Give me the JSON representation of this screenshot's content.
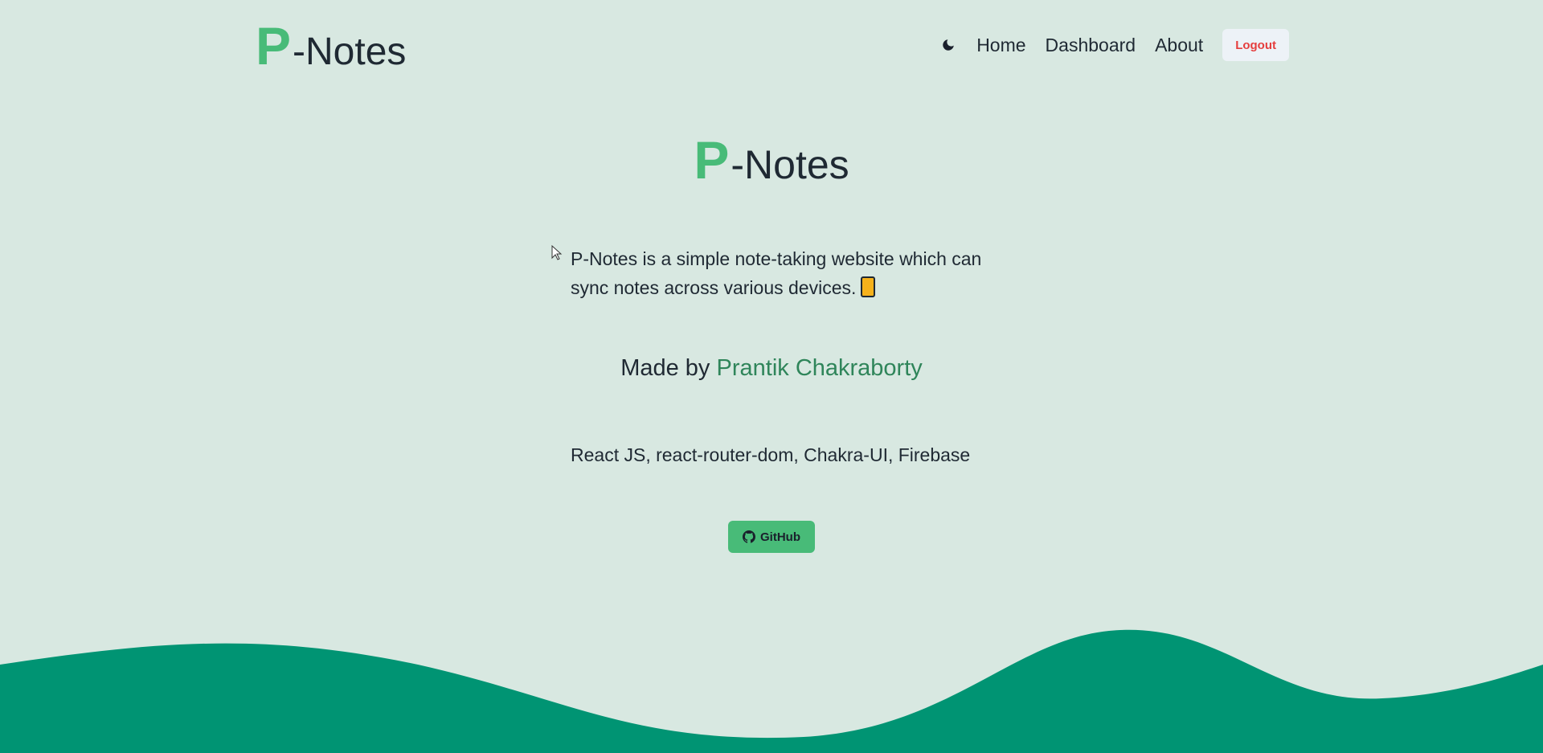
{
  "header": {
    "brand_p": "P",
    "brand_rest": "-Notes",
    "nav": {
      "home": "Home",
      "dashboard": "Dashboard",
      "about": "About"
    },
    "logout_label": "Logout",
    "theme_icon": "moon-icon"
  },
  "main": {
    "title_p": "P",
    "title_rest": "-Notes",
    "description": "P-Notes is a simple note-taking website which can sync notes across various devices.",
    "made_by_prefix": "Made by",
    "author": "Prantik Chakraborty",
    "tech_stack": "React JS, react-router-dom, Chakra-UI, Firebase",
    "github_label": "GitHub"
  },
  "colors": {
    "background": "#d8e8e1",
    "brand_accent": "#48bb78",
    "logout_text": "#e53e3e",
    "author_link": "#2f855a",
    "wave": "#009473"
  }
}
